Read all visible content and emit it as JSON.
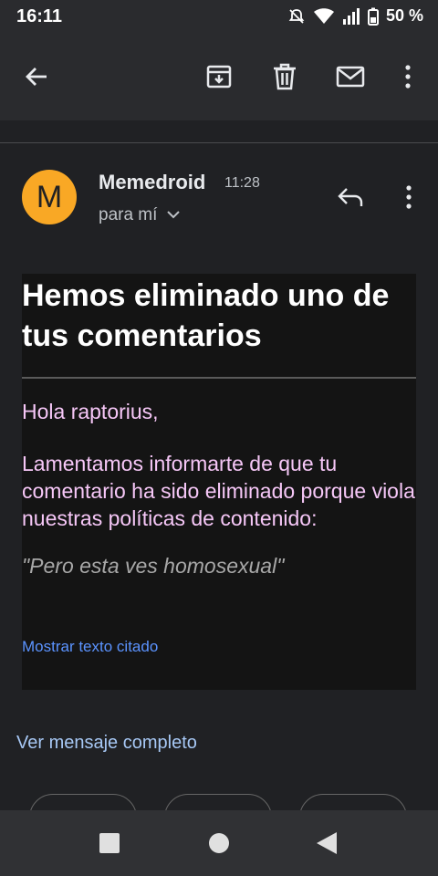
{
  "status_bar": {
    "time": "16:11",
    "battery": "50 %"
  },
  "toolbar": {
    "icons": [
      "back-arrow-icon",
      "archive-icon",
      "trash-icon",
      "mail-icon",
      "more-vert-icon"
    ]
  },
  "email": {
    "sender_initial": "M",
    "sender_name": "Memedroid",
    "time": "11:28",
    "recipient": "para mí",
    "title": "Hemos eliminado uno de tus comentarios",
    "greeting": "Hola raptorius,",
    "body": "Lamentamos informarte de que tu comentario ha sido eliminado porque viola nuestras políticas de contenido:",
    "quoted_comment": "\"Pero esta ves homosexual\"",
    "show_quoted_label": "Mostrar texto citado"
  },
  "footer": {
    "view_full_label": "Ver mensaje completo"
  },
  "colors": {
    "background": "#202124",
    "avatar": "#f9a825",
    "body_text": "#f6c7f7",
    "link": "#5b93ff"
  }
}
